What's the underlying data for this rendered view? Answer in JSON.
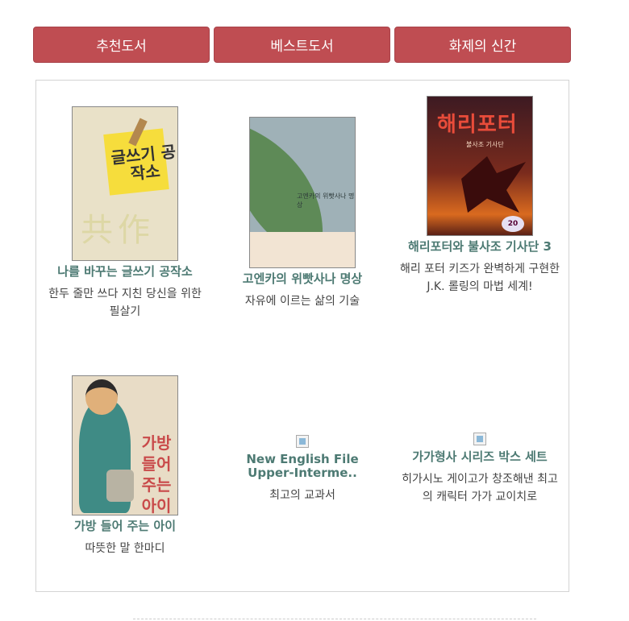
{
  "tabs": [
    {
      "label": "추천도서"
    },
    {
      "label": "베스트도서"
    },
    {
      "label": "화제의 신간"
    }
  ],
  "books": [
    {
      "title": "나를 바꾸는 글쓰기 공작소",
      "desc": "한두 줄만 쓰다 지친 당신을 위한 필살기",
      "cover_text": "글쓰기 공작소"
    },
    {
      "title": "고엔카의 위빳사나 명상",
      "desc": "자유에 이르는 삶의 기술",
      "cover_text": "고엔카의 위빳사나 명상"
    },
    {
      "title": "해리포터와 불사조 기사단 3",
      "desc": "해리 포터 키즈가 완벽하게 구현한 J.K. 롤링의 마법 세계!",
      "cover_text": "해리포터",
      "cover_sub": "불사조 기사단",
      "badge": "20"
    },
    {
      "title": "가방 들어 주는 아이",
      "desc": "따뜻한 말 한마디",
      "cover_text": "가방 들어 주는 아이"
    },
    {
      "title": "New English File Upper-Interme..",
      "desc": "최고의 교과서"
    },
    {
      "title": "가가형사 시리즈 박스 세트",
      "desc": "히가시노 게이고가 창조해낸 최고의 캐릭터 가가 교이치로"
    }
  ]
}
